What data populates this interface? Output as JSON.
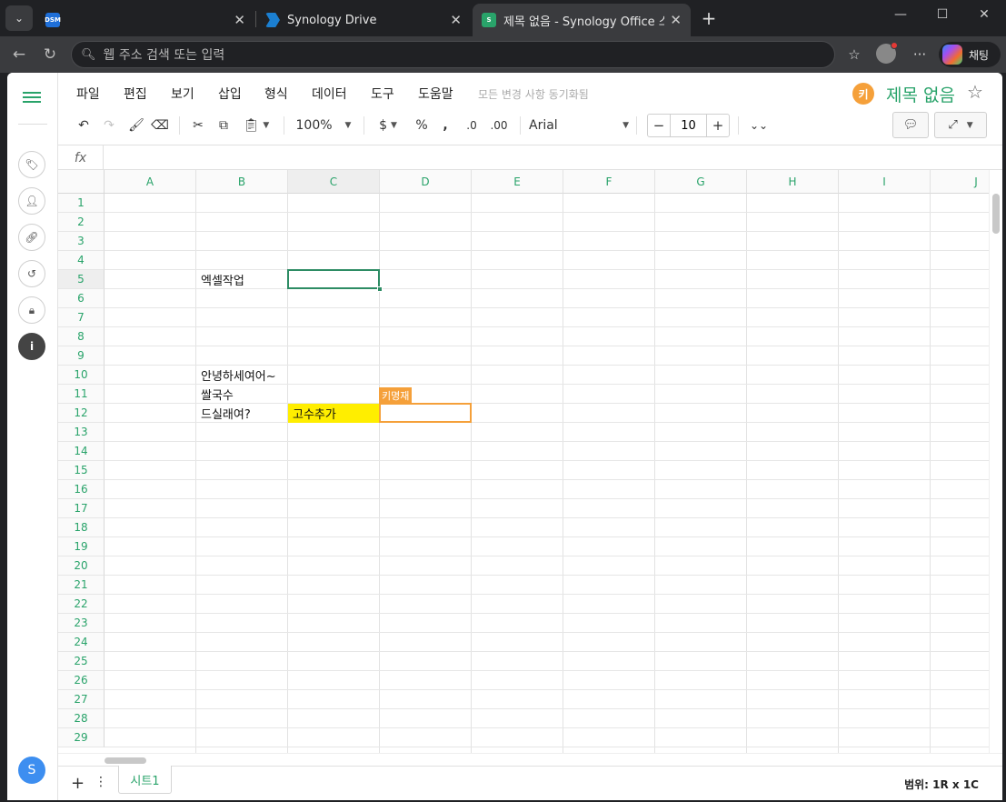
{
  "browser": {
    "tabs": [
      {
        "label": "",
        "icon": "DSM"
      },
      {
        "label": "Synology Drive"
      },
      {
        "label": "제목 없음 - Synology Office 스프레"
      }
    ],
    "address_placeholder": "웹 주소 검색 또는 입력",
    "copilot_label": "채팅"
  },
  "menubar": {
    "items": [
      "파일",
      "편집",
      "보기",
      "삽입",
      "형식",
      "데이터",
      "도구",
      "도움말"
    ],
    "status": "모든 변경 사항 동기화됨",
    "user_badge": "키",
    "doc_title": "제목 없음"
  },
  "toolbar": {
    "zoom": "100%",
    "currency": "$",
    "percent": "%",
    "comma": ",",
    "dec_decrease": ".0",
    "dec_increase": ".00",
    "font": "Arial",
    "font_size": "10"
  },
  "formula": {
    "fx_label": "fx",
    "value": ""
  },
  "grid": {
    "columns": [
      "A",
      "B",
      "C",
      "D",
      "E",
      "F",
      "G",
      "H",
      "I",
      "J"
    ],
    "rows": [
      "1",
      "2",
      "3",
      "4",
      "5",
      "6",
      "7",
      "8",
      "9",
      "10",
      "11",
      "12",
      "13",
      "14",
      "15",
      "16",
      "17",
      "18",
      "19",
      "20",
      "21",
      "22",
      "23",
      "24",
      "25",
      "26",
      "27",
      "28",
      "29"
    ],
    "cells": {
      "B5": "엑셀작업",
      "B10": "안녕하세여어~",
      "B11": "쌀국수",
      "B12": "드실래여?",
      "C12": "고수추가"
    },
    "highlight_color": "#ffee00",
    "selected_cell": "C5",
    "collaborator": {
      "name": "키명재",
      "cell": "D12",
      "color": "#f5a03a"
    }
  },
  "sheets": [
    "시트1"
  ],
  "status": "범위: 1R x 1C",
  "left_sidebar": {
    "avatar": "S"
  }
}
